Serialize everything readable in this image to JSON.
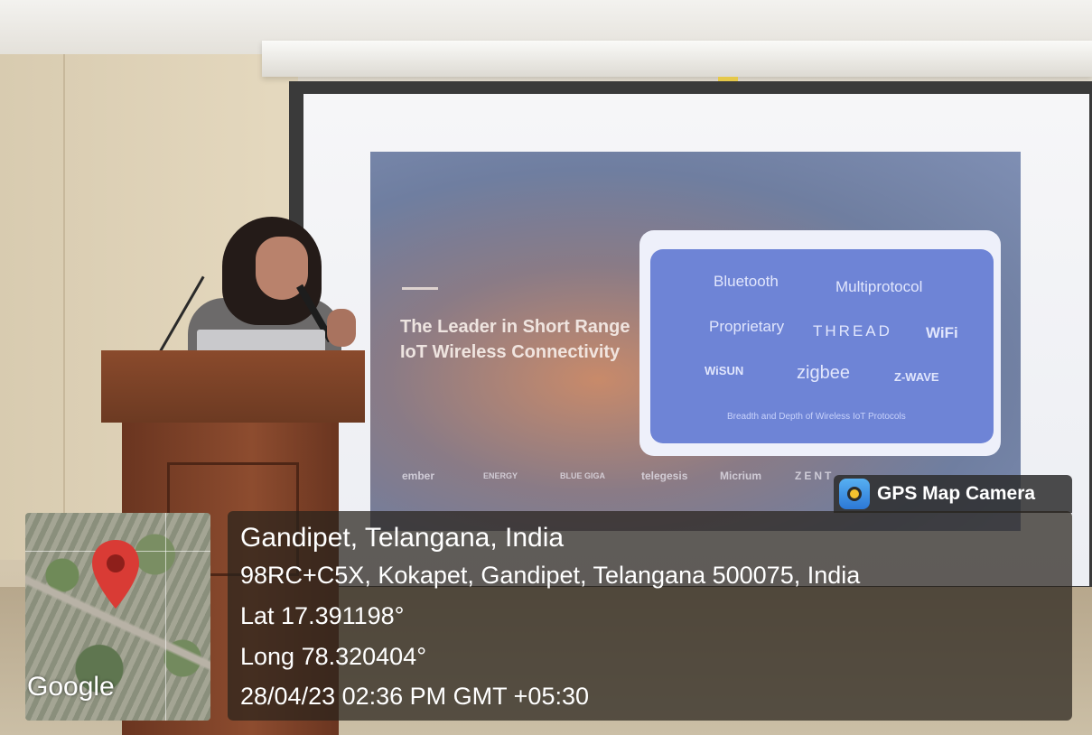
{
  "slide": {
    "title": "The Leader in Short Range IoT Wireless Connectivity",
    "protocols": [
      "Bluetooth",
      "Multiprotocol",
      "Proprietary",
      "THREAD",
      "WiFi",
      "WiSUN",
      "zigbee",
      "Z-WAVE"
    ],
    "caption": "Breadth and Depth of Wireless IoT Protocols",
    "timeline": [
      "ember",
      "ENERGY",
      "BLUE GIGA",
      "telegesis",
      "Micrium",
      "ZENT"
    ]
  },
  "map": {
    "logo": "Google"
  },
  "badge": {
    "label": "GPS Map Camera"
  },
  "location": {
    "title": "Gandipet, Telangana, India",
    "address": "98RC+C5X, Kokapet, Gandipet, Telangana 500075, India",
    "lat": "Lat 17.391198°",
    "long": "Long 78.320404°",
    "datetime": "28/04/23 02:36 PM GMT +05:30"
  },
  "colors": {
    "pin": "#d93b35",
    "slide_card": "#6e84d6",
    "podium": "#7a4028"
  }
}
